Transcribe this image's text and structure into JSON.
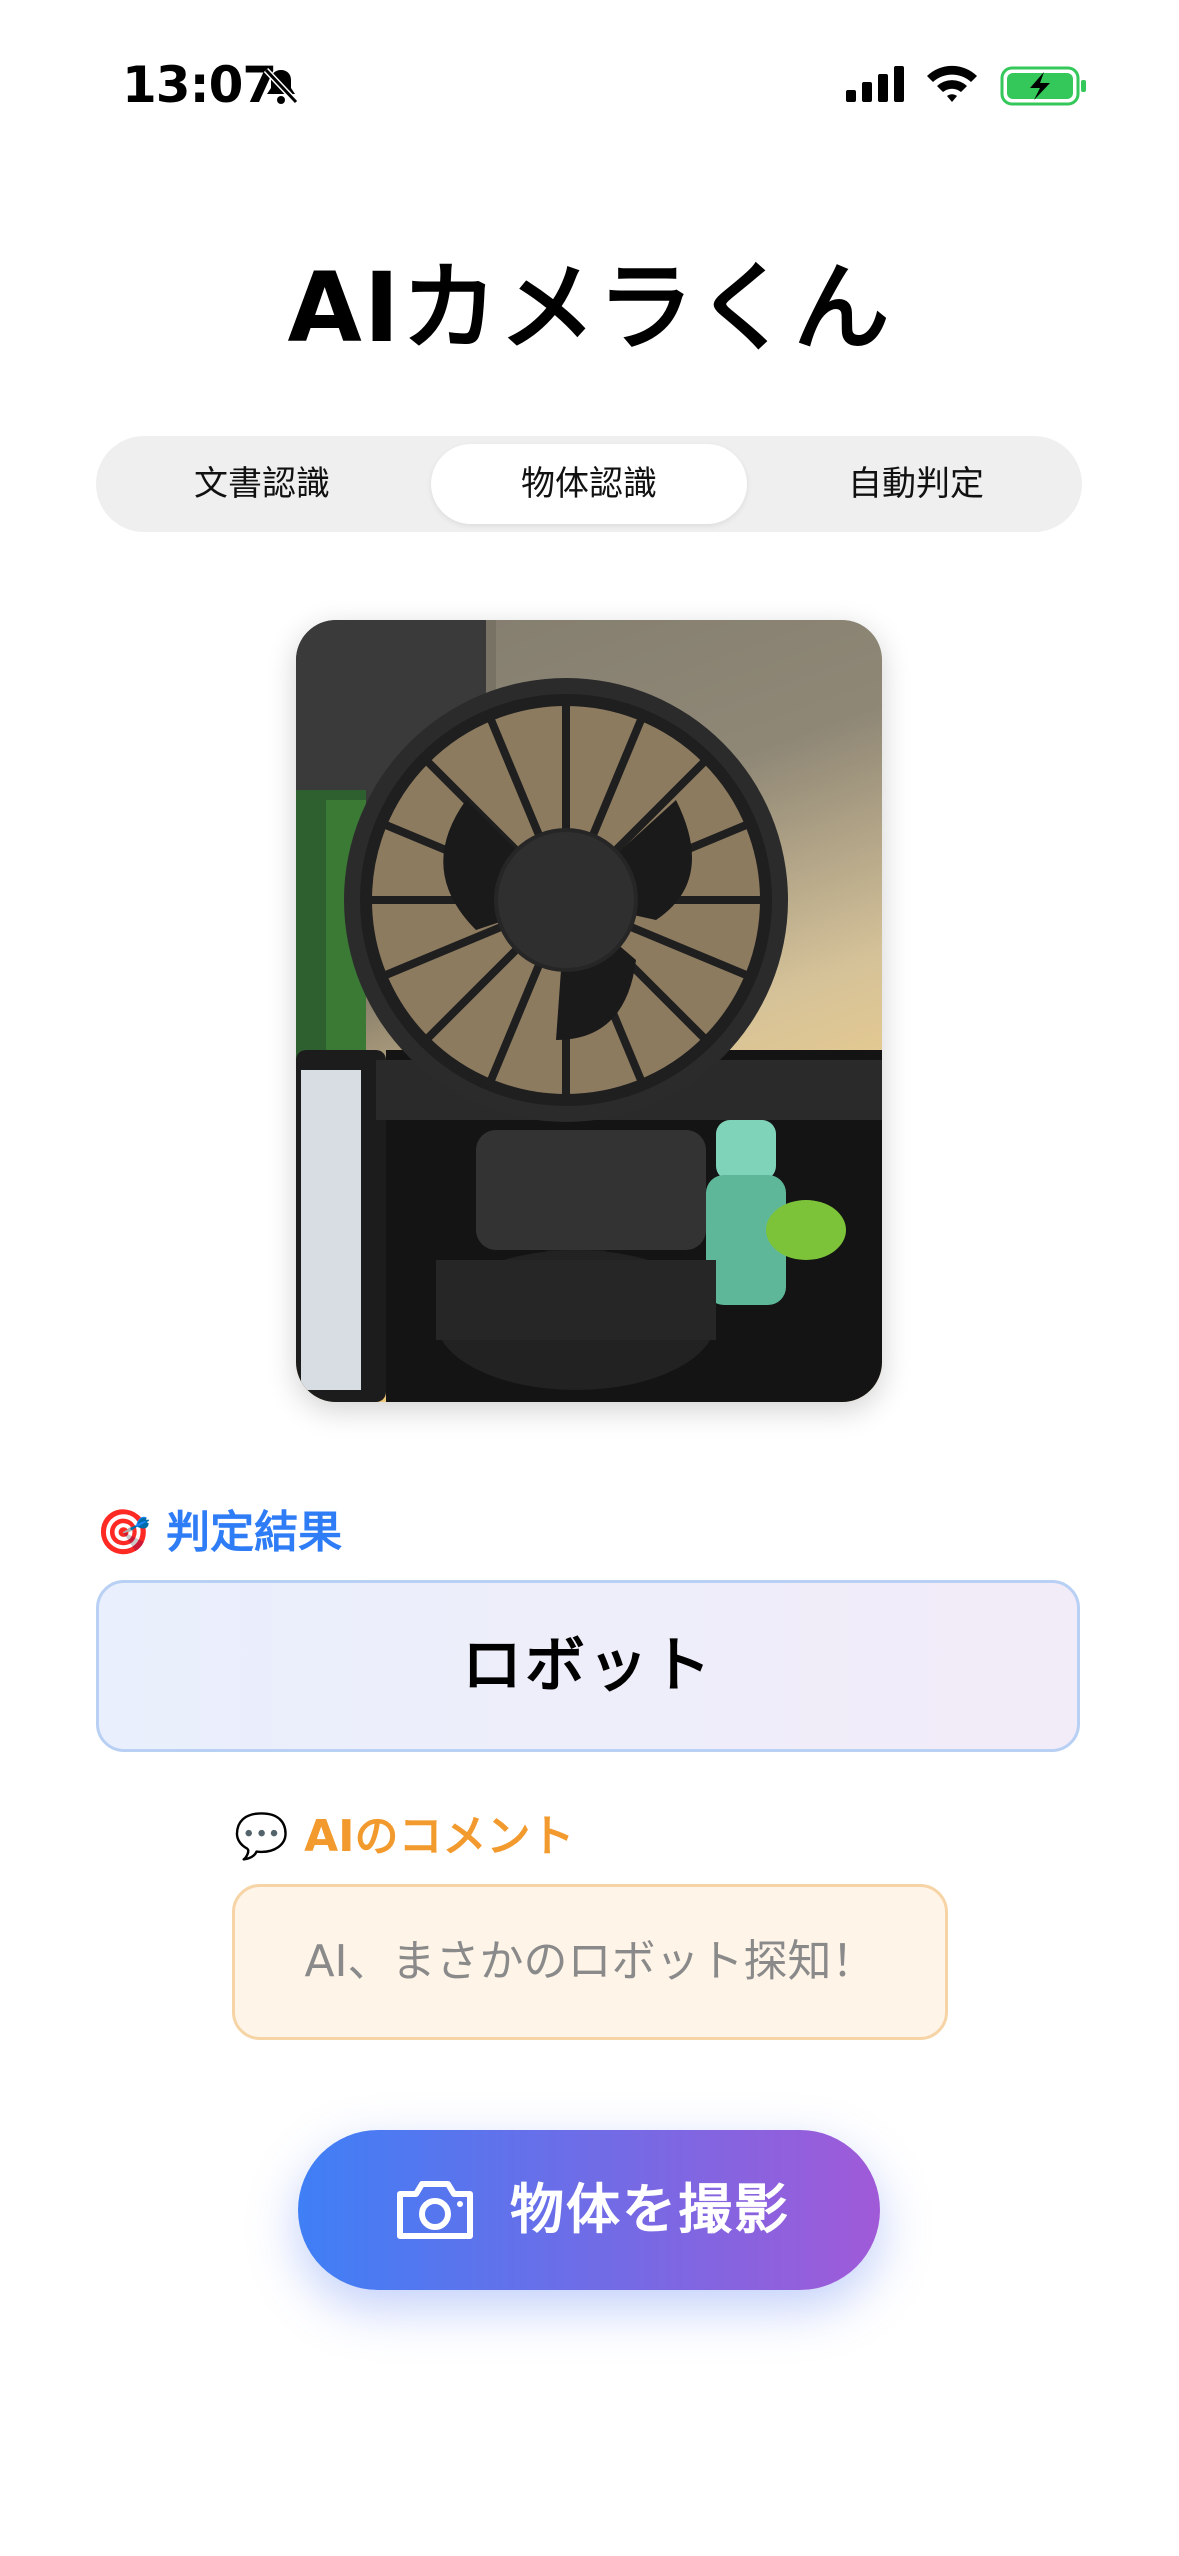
{
  "status_bar": {
    "time": "13:07",
    "icons": [
      "bell-slash-icon",
      "cellular-signal-icon",
      "wifi-icon",
      "battery-charging-icon"
    ],
    "battery_color": "#34c759"
  },
  "app": {
    "title": "AIカメラくん"
  },
  "segments": {
    "tabs": [
      "文書認識",
      "物体認識",
      "自動判定"
    ],
    "selected": "物体認識"
  },
  "preview": {
    "icon": "photo-preview-fan"
  },
  "result": {
    "emoji": "🎯",
    "title": "判定結果",
    "value": "ロボット",
    "accent": "#2e7cf6"
  },
  "comment": {
    "emoji": "💬",
    "title": "AIのコメント",
    "text": "AI、まさかのロボット探知！",
    "accent": "#f29a2e"
  },
  "capture_button": {
    "label": "物体を撮影",
    "icon": "camera-icon"
  }
}
